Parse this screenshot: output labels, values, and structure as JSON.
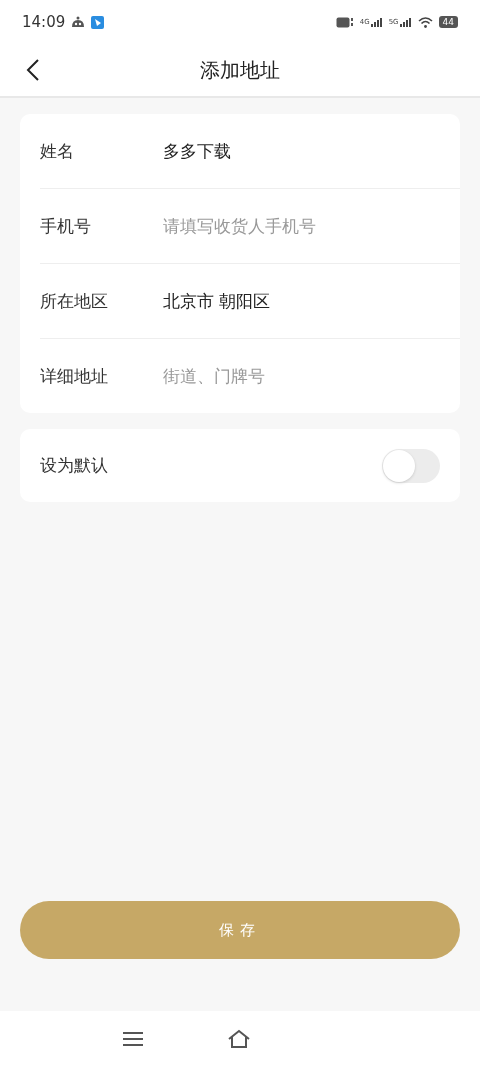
{
  "status_bar": {
    "time": "14:09",
    "network_1": "4G",
    "network_2": "5G",
    "battery": "44"
  },
  "header": {
    "title": "添加地址"
  },
  "form": {
    "fields": [
      {
        "label": "姓名",
        "value": "多多下载"
      },
      {
        "label": "手机号",
        "placeholder": "请填写收货人手机号"
      },
      {
        "label": "所在地区",
        "value": "北京市 朝阳区"
      },
      {
        "label": "详细地址",
        "placeholder": "街道、门牌号"
      }
    ]
  },
  "default_setting": {
    "label": "设为默认",
    "on": false
  },
  "save_button": {
    "label": "保存"
  }
}
